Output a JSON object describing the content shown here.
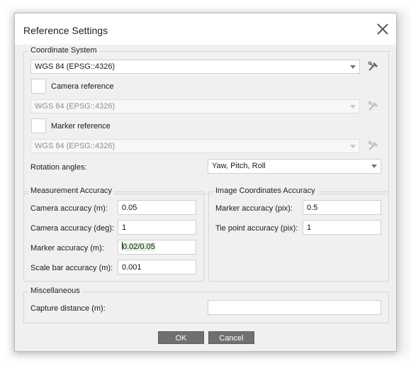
{
  "dialog": {
    "title": "Reference Settings"
  },
  "coordinate_system": {
    "legend": "Coordinate System",
    "main_crs": "WGS 84 (EPSG::4326)",
    "camera_reference_label": "Camera reference",
    "camera_crs": "WGS 84 (EPSG::4326)",
    "marker_reference_label": "Marker reference",
    "marker_crs": "WGS 84 (EPSG::4326)",
    "rotation_angles_label": "Rotation angles:",
    "rotation_angles_value": "Yaw, Pitch, Roll"
  },
  "measurement_accuracy": {
    "legend": "Measurement Accuracy",
    "rows": [
      {
        "label": "Camera accuracy (m):",
        "value": "0.05"
      },
      {
        "label": "Camera accuracy (deg):",
        "value": "1"
      },
      {
        "label": "Marker accuracy (m):",
        "value_prefix": "",
        "value": "0.02/0.05"
      },
      {
        "label": "Scale bar accuracy (m):",
        "value": "0.001"
      }
    ]
  },
  "image_coordinates_accuracy": {
    "legend": "Image Coordinates Accuracy",
    "rows": [
      {
        "label": "Marker accuracy (pix):",
        "value": "0.5"
      },
      {
        "label": "Tie point accuracy (pix):",
        "value": "1"
      }
    ]
  },
  "miscellaneous": {
    "legend": "Miscellaneous",
    "capture_distance_label": "Capture distance (m):",
    "capture_distance_value": ""
  },
  "buttons": {
    "ok": "OK",
    "cancel": "Cancel"
  },
  "icons": {
    "crs_tool": "crs-settings-icon",
    "close": "close-icon"
  }
}
